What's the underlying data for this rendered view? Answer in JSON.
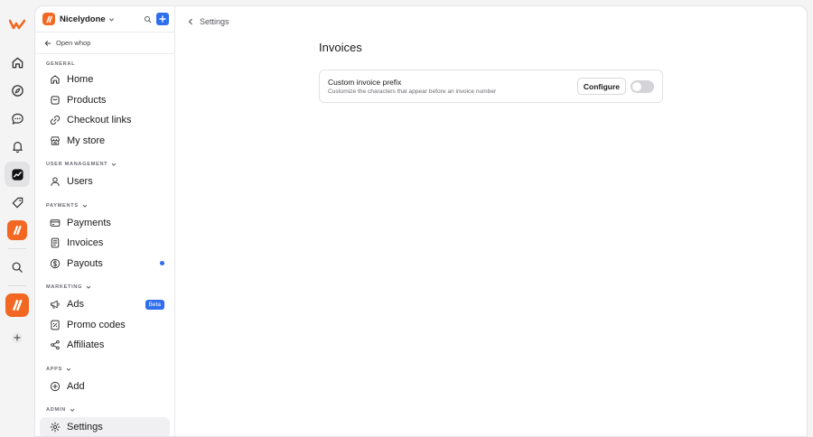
{
  "workspace": {
    "name": "Nicelydone"
  },
  "sidebar": {
    "open_whop": "Open whop",
    "groups": [
      {
        "label": "GENERAL",
        "items": [
          {
            "label": "Home"
          },
          {
            "label": "Products"
          },
          {
            "label": "Checkout links"
          },
          {
            "label": "My store"
          }
        ]
      },
      {
        "label": "USER MANAGEMENT",
        "items": [
          {
            "label": "Users"
          }
        ]
      },
      {
        "label": "PAYMENTS",
        "items": [
          {
            "label": "Payments"
          },
          {
            "label": "Invoices"
          },
          {
            "label": "Payouts"
          }
        ]
      },
      {
        "label": "MARKETING",
        "items": [
          {
            "label": "Ads",
            "badge": "Beta"
          },
          {
            "label": "Promo codes"
          },
          {
            "label": "Affiliates"
          }
        ]
      },
      {
        "label": "APPS",
        "items": [
          {
            "label": "Add"
          }
        ]
      },
      {
        "label": "ADMIN",
        "items": [
          {
            "label": "Settings"
          }
        ]
      }
    ]
  },
  "rail": {
    "icons": [
      "whop-logo-icon",
      "home-icon",
      "compass-icon",
      "chat-icon",
      "bell-icon",
      "dashboard-icon",
      "tag-icon",
      "app-icon",
      "search-icon",
      "app-icon",
      "add-icon"
    ]
  },
  "main": {
    "breadcrumb": "Settings",
    "title": "Invoices",
    "setting": {
      "title": "Custom invoice prefix",
      "description": "Customize the characters that appear before an invoice number",
      "button": "Configure",
      "enabled": false
    }
  },
  "colors": {
    "brand": "#f26822",
    "accent": "#2f6fed",
    "toggle_off": "#d4d4d8"
  }
}
